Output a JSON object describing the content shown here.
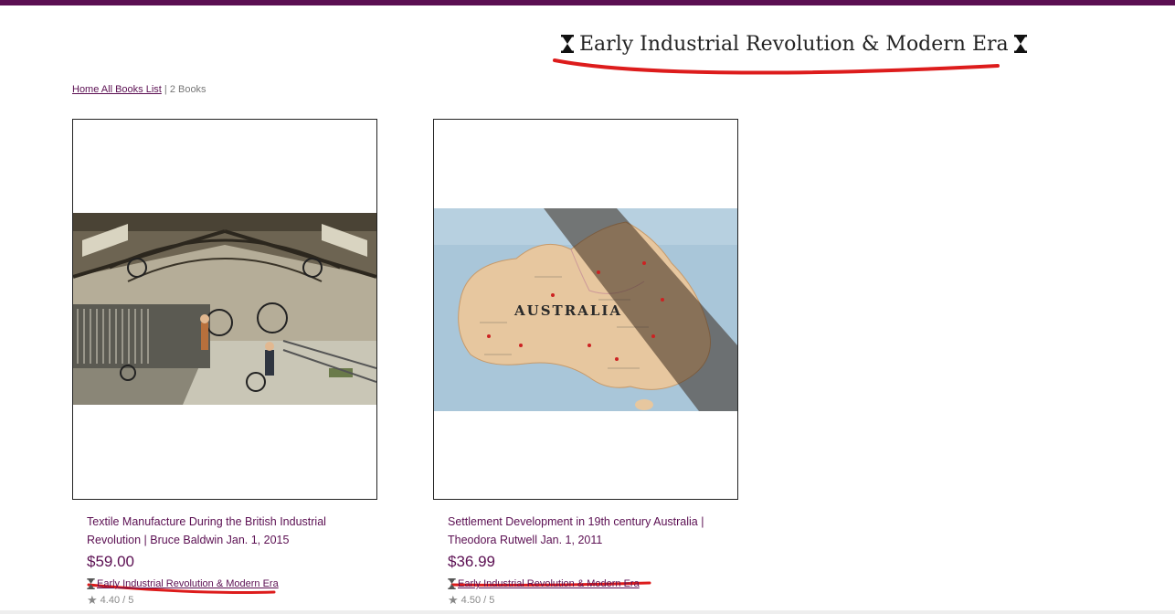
{
  "header": {
    "title": "Early Industrial Revolution & Modern Era",
    "icon": "hourglass-icon",
    "accent_color": "#5b0f52"
  },
  "breadcrumb": {
    "home_link": "Home All Books List",
    "separator": "|",
    "count": "2 Books"
  },
  "books": [
    {
      "title": "Textile Manufacture During the British Industrial Revolution | Bruce Baldwin Jan. 1, 2015",
      "price": "$59.00",
      "category": "Early Industrial Revolution & Modern Era",
      "rating": "4.40 / 5",
      "image": "textile-mill-engraving"
    },
    {
      "title": "Settlement Development in 19th century Australia | Theodora Rutwell Jan. 1, 2011",
      "price": "$36.99",
      "category": "Early Industrial Revolution & Modern Era",
      "rating": "4.50 / 5",
      "image": "australia-map-photo",
      "map_label": "AUSTRALIA"
    }
  ],
  "annotation_color": "#dd1c1c"
}
